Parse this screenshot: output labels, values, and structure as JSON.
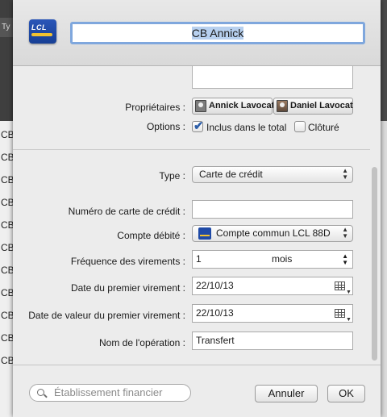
{
  "background_app": {
    "header_text": "Ty",
    "row_text": "CB",
    "rows": [
      "CB",
      "CB",
      "CB",
      "CB",
      "CB",
      "CB",
      "CB",
      "CB",
      "CB",
      "CB",
      "CB"
    ]
  },
  "header": {
    "account_name": "CB Annick",
    "logo_text": "LCL"
  },
  "owners": {
    "label": "Propriétaires :",
    "items": [
      "Annick Lavocat",
      "Daniel Lavocat"
    ]
  },
  "options": {
    "label": "Options :",
    "include_in_total": {
      "label": "Inclus dans le total",
      "checked": true
    },
    "closed": {
      "label": "Clôturé",
      "checked": false
    }
  },
  "type": {
    "label": "Type :",
    "value": "Carte de crédit"
  },
  "card_number": {
    "label": "Numéro de carte de crédit :",
    "value": ""
  },
  "debit_account": {
    "label": "Compte débité :",
    "value": "Compte commun LCL 88D"
  },
  "transfer_frequency": {
    "label": "Fréquence des virements :",
    "count": "1",
    "unit": "mois"
  },
  "first_transfer_date": {
    "label": "Date du premier virement :",
    "value": "22/10/13"
  },
  "first_value_date": {
    "label": "Date de valeur du premier virement :",
    "value": "22/10/13"
  },
  "operation_name": {
    "label": "Nom de l'opération :",
    "value": "Transfert"
  },
  "footer": {
    "search_placeholder": "Établissement financier",
    "cancel_label": "Annuler",
    "ok_label": "OK"
  },
  "colors": {
    "sheet_background": "#ececec",
    "focus_ring": "#7fa7dd",
    "selection": "#b7d0ef",
    "lcl_blue": "#1f4aa6",
    "lcl_yellow": "#f2c230"
  }
}
